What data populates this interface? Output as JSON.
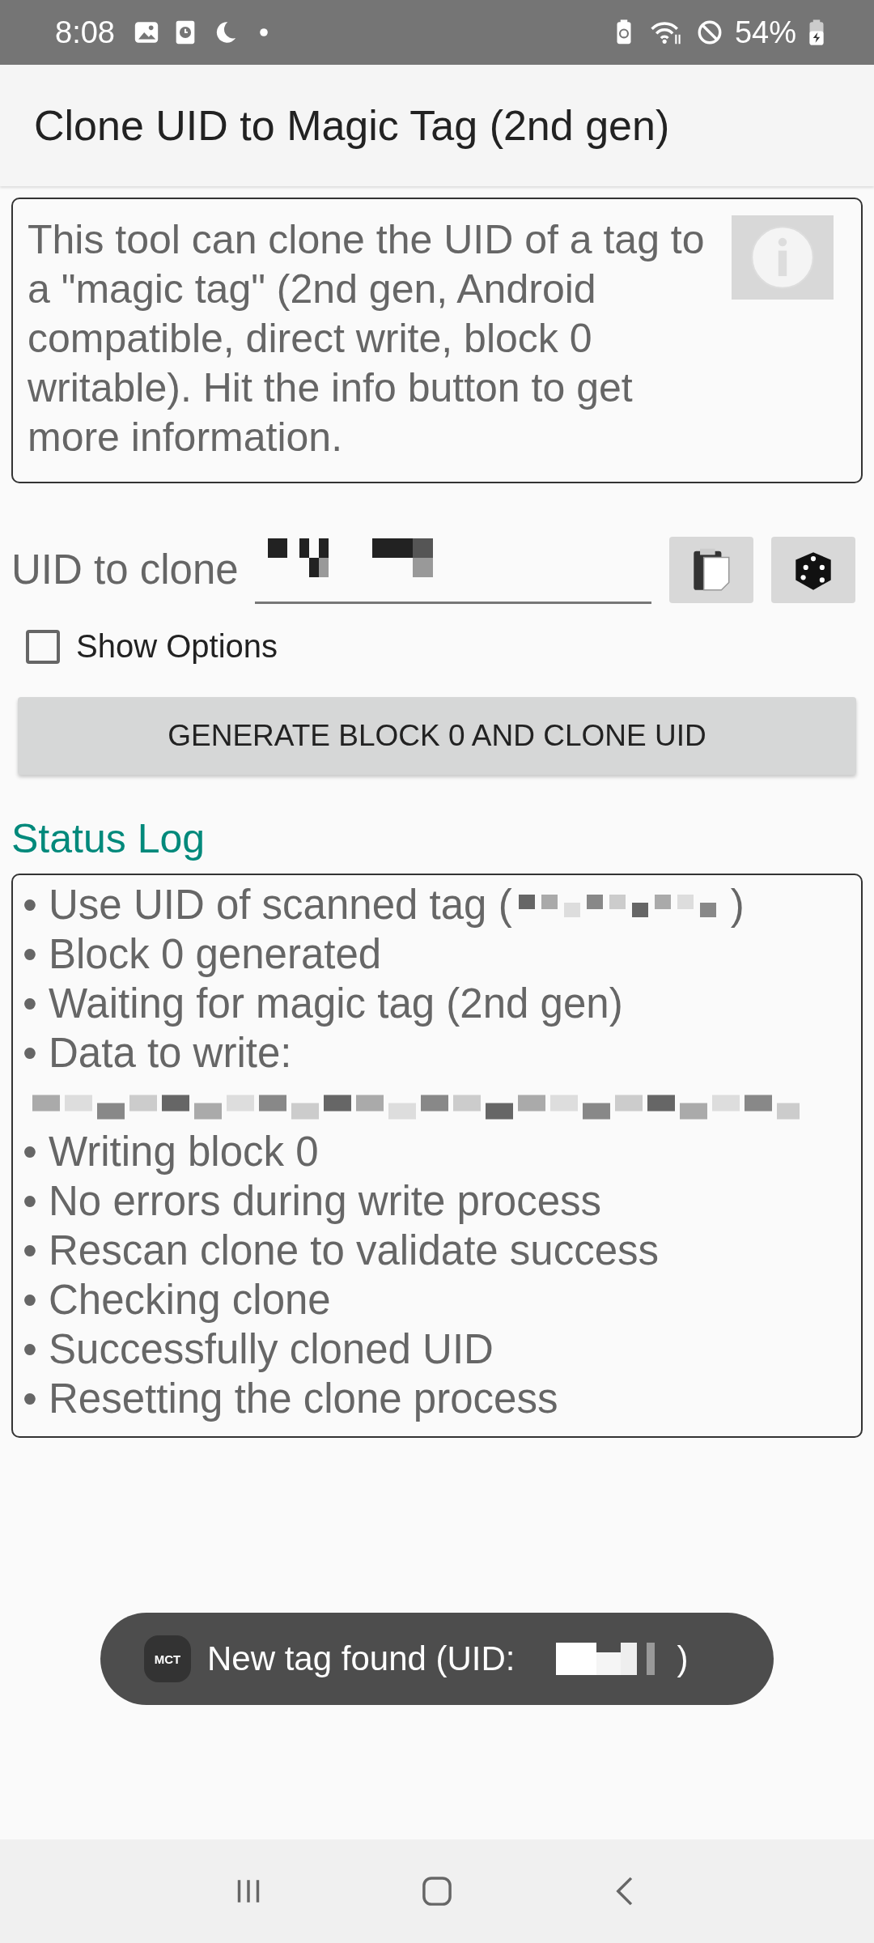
{
  "status_bar": {
    "time": "8:08",
    "battery": "54%"
  },
  "app_bar": {
    "title": "Clone UID to Magic Tag (2nd gen)"
  },
  "intro": {
    "text": "This tool can clone the UID of a tag to a \"magic tag\" (2nd gen, Android compatible, direct write, block 0 writable). Hit the info button to get more information."
  },
  "uid_row": {
    "label": "UID to clone",
    "value_redacted": true
  },
  "show_options": {
    "label": "Show Options",
    "checked": false
  },
  "generate_button": {
    "label": "GENERATE BLOCK 0 AND CLONE UID"
  },
  "status_log": {
    "title": "Status Log",
    "lines": [
      {
        "kind": "redacted_inline",
        "prefix": "• Use UID of scanned tag (",
        "suffix": ")"
      },
      {
        "kind": "text",
        "text": "• Block 0 generated"
      },
      {
        "kind": "text",
        "text": "• Waiting for magic tag (2nd gen)"
      },
      {
        "kind": "text",
        "text": "• Data to write:"
      },
      {
        "kind": "redacted_line"
      },
      {
        "kind": "text",
        "text": "• Writing block 0"
      },
      {
        "kind": "text",
        "text": "• No errors during write process"
      },
      {
        "kind": "text",
        "text": "• Rescan clone to validate success"
      },
      {
        "kind": "text",
        "text": "• Checking clone"
      },
      {
        "kind": "text",
        "text": "• Successfully cloned UID"
      },
      {
        "kind": "text",
        "text": "• Resetting the clone process"
      }
    ]
  },
  "toast": {
    "app_icon_label": "MCT",
    "prefix": "New tag found (UID:",
    "suffix": ")"
  }
}
